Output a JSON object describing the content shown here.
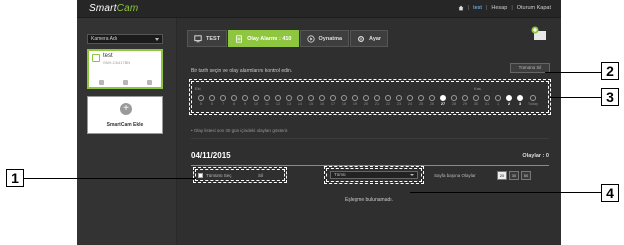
{
  "header": {
    "logo_main": "Smart",
    "logo_accent": "Cam",
    "links": [
      "test",
      "Hesap",
      "Oturum Kapat"
    ],
    "separator": "|"
  },
  "sidebar": {
    "camera_select": "Kamera Adı",
    "camera": {
      "name": "test",
      "serial": "SNH-C6417BN"
    },
    "add_label": "SmartCam Ekle"
  },
  "tabs": [
    {
      "label": "TEST"
    },
    {
      "label": "Olay Alarmı : 410"
    },
    {
      "label": "Oynatma"
    },
    {
      "label": "Ayar"
    }
  ],
  "instruction": "Bir tarih seçin ve olay alarmlarını kontrol edin.",
  "all_button": "Tümünü Sil",
  "timeline": {
    "month_labels": [
      "Eki",
      "Kas"
    ],
    "days": [
      {
        "n": "5",
        "event": false
      },
      {
        "n": "6",
        "event": false
      },
      {
        "n": "7",
        "event": false
      },
      {
        "n": "8",
        "event": false
      },
      {
        "n": "9",
        "event": false
      },
      {
        "n": "10",
        "event": false
      },
      {
        "n": "11",
        "event": false
      },
      {
        "n": "12",
        "event": false
      },
      {
        "n": "13",
        "event": false
      },
      {
        "n": "14",
        "event": false
      },
      {
        "n": "15",
        "event": false
      },
      {
        "n": "16",
        "event": false
      },
      {
        "n": "17",
        "event": false
      },
      {
        "n": "18",
        "event": false
      },
      {
        "n": "19",
        "event": false
      },
      {
        "n": "20",
        "event": false
      },
      {
        "n": "21",
        "event": false
      },
      {
        "n": "22",
        "event": false
      },
      {
        "n": "23",
        "event": false
      },
      {
        "n": "24",
        "event": false
      },
      {
        "n": "25",
        "event": false
      },
      {
        "n": "26",
        "event": false
      },
      {
        "n": "27",
        "event": true
      },
      {
        "n": "28",
        "event": false
      },
      {
        "n": "29",
        "event": false
      },
      {
        "n": "30",
        "event": false
      },
      {
        "n": "31",
        "event": false
      },
      {
        "n": "1",
        "event": false
      },
      {
        "n": "2",
        "event": true
      },
      {
        "n": "3",
        "event": true
      },
      {
        "n": "Today",
        "event": false
      }
    ]
  },
  "note": "• Olay listesi son 30 gün içindeki olayları gösterir.",
  "list": {
    "date": "04/11/2015",
    "count_label": "Olaylar : 0",
    "select_all": "Tümünü Seç",
    "delete": "Sil",
    "filter": "Tümü",
    "per_page_label": "Sayfa başına Olaylar",
    "per_page_options": [
      "20",
      "30",
      "50"
    ],
    "empty": "Eşleşme bulunamadı."
  },
  "callouts": [
    "1",
    "2",
    "3",
    "4"
  ],
  "colors": {
    "accent": "#8ec63f",
    "bg": "#2f2f2f"
  }
}
